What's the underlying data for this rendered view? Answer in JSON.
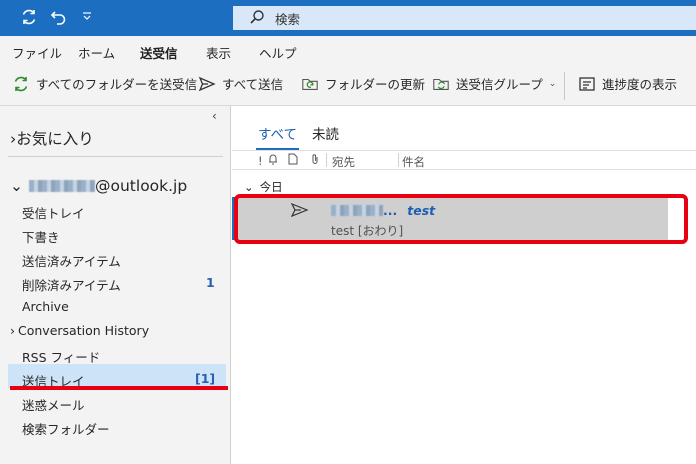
{
  "titlebar": {
    "search_placeholder": "検索"
  },
  "menu": {
    "tabs": [
      {
        "label": "ファイル"
      },
      {
        "label": "ホーム"
      },
      {
        "label": "送受信",
        "active": true
      },
      {
        "label": "表示"
      },
      {
        "label": "ヘルプ"
      }
    ]
  },
  "ribbon": {
    "buttons": [
      {
        "label": "すべてのフォルダーを送受信",
        "icon": "sync-all-icon"
      },
      {
        "label": "すべて送信",
        "icon": "send-icon"
      },
      {
        "label": "フォルダーの更新",
        "icon": "folder-refresh-icon"
      },
      {
        "label": "送受信グループ",
        "icon": "send-receive-group-icon"
      },
      {
        "label": "進捗度の表示",
        "icon": "progress-icon"
      }
    ]
  },
  "folders": {
    "favorites_label": "お気に入り",
    "account_domain": "@outlook.jp",
    "items": [
      {
        "label": "受信トレイ"
      },
      {
        "label": "下書き"
      },
      {
        "label": "送信済みアイテム"
      },
      {
        "label": "削除済みアイテム",
        "count": "1"
      },
      {
        "label": "Archive"
      },
      {
        "label": "Conversation History"
      },
      {
        "label": "RSS フィード"
      },
      {
        "label": "送信トレイ",
        "count": "[1]",
        "selected": true
      },
      {
        "label": "迷惑メール"
      },
      {
        "label": "検索フォルダー"
      }
    ]
  },
  "message_list": {
    "tabs": [
      {
        "label": "すべて",
        "active": true
      },
      {
        "label": "未読"
      }
    ],
    "columns": {
      "importance": "!",
      "to": "宛先",
      "subject": "件名"
    },
    "group_label": "今日",
    "messages": [
      {
        "to_suffix": "...",
        "subject": "test",
        "preview": "test [おわり]"
      }
    ]
  },
  "colors": {
    "accent": "#1c6fc0",
    "highlight": "#e60012",
    "selected_folder": "#cde3f7"
  }
}
